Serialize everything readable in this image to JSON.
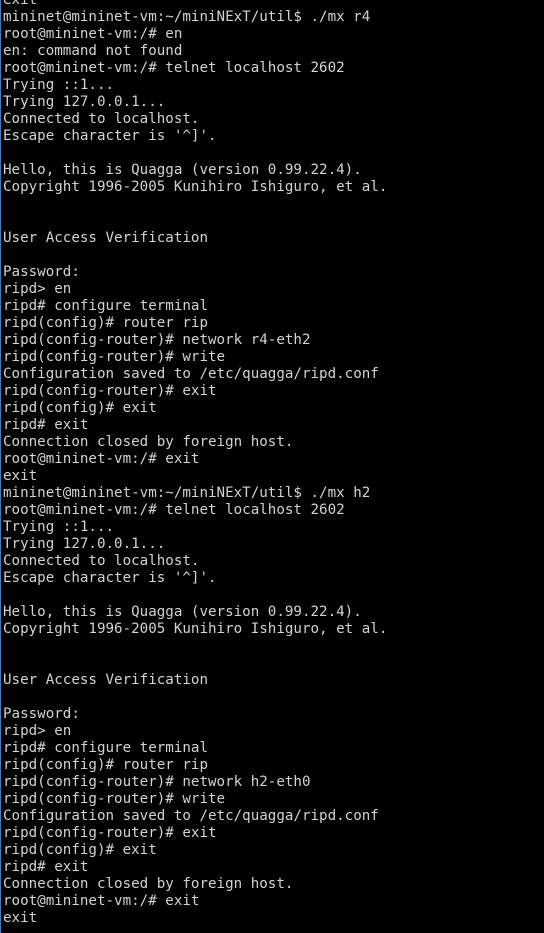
{
  "terminal": {
    "lines": [
      "exit",
      "mininet@mininet-vm:~/miniNExT/util$ ./mx r4",
      "root@mininet-vm:/# en",
      "en: command not found",
      "root@mininet-vm:/# telnet localhost 2602",
      "Trying ::1...",
      "Trying 127.0.0.1...",
      "Connected to localhost.",
      "Escape character is '^]'.",
      "",
      "Hello, this is Quagga (version 0.99.22.4).",
      "Copyright 1996-2005 Kunihiro Ishiguro, et al.",
      "",
      "",
      "User Access Verification",
      "",
      "Password:",
      "ripd> en",
      "ripd# configure terminal",
      "ripd(config)# router rip",
      "ripd(config-router)# network r4-eth2",
      "ripd(config-router)# write",
      "Configuration saved to /etc/quagga/ripd.conf",
      "ripd(config-router)# exit",
      "ripd(config)# exit",
      "ripd# exit",
      "Connection closed by foreign host.",
      "root@mininet-vm:/# exit",
      "exit",
      "mininet@mininet-vm:~/miniNExT/util$ ./mx h2",
      "root@mininet-vm:/# telnet localhost 2602",
      "Trying ::1...",
      "Trying 127.0.0.1...",
      "Connected to localhost.",
      "Escape character is '^]'.",
      "",
      "Hello, this is Quagga (version 0.99.22.4).",
      "Copyright 1996-2005 Kunihiro Ishiguro, et al.",
      "",
      "",
      "User Access Verification",
      "",
      "Password:",
      "ripd> en",
      "ripd# configure terminal",
      "ripd(config)# router rip",
      "ripd(config-router)# network h2-eth0",
      "ripd(config-router)# write",
      "Configuration saved to /etc/quagga/ripd.conf",
      "ripd(config-router)# exit",
      "ripd(config)# exit",
      "ripd# exit",
      "Connection closed by foreign host.",
      "root@mininet-vm:/# exit",
      "exit"
    ]
  }
}
